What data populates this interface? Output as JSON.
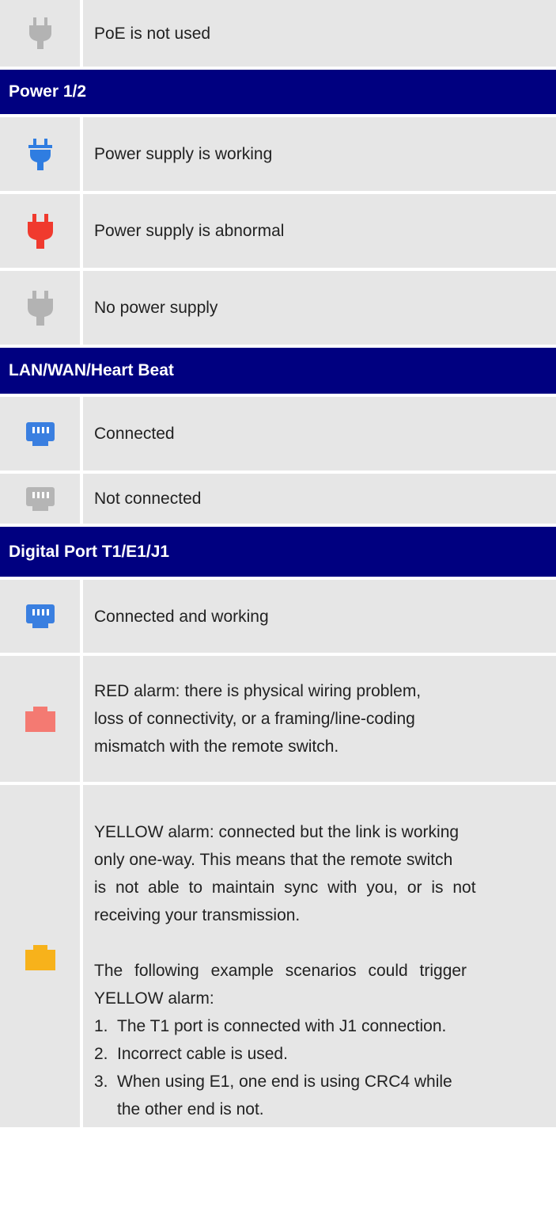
{
  "rows": {
    "poe_not_used": "PoE is not used",
    "power_header": "Power 1/2",
    "power_working": "Power supply is working",
    "power_abnormal": "Power supply is abnormal",
    "no_power": "No power supply",
    "lan_header": "LAN/WAN/Heart Beat",
    "lan_connected": "Connected",
    "lan_not_connected": "Not connected",
    "digital_header": "Digital Port T1/E1/J1",
    "digital_connected": "Connected and working",
    "red_alarm": [
      "RED alarm: there is physical wiring problem,",
      "loss of connectivity, or a framing/line-coding",
      "mismatch with the remote switch."
    ],
    "yellow_alarm": [
      "YELLOW alarm: connected but the link is working",
      "only one-way. This means that the remote switch",
      "is not able to maintain sync with you, or is not",
      "receiving your transmission."
    ],
    "yellow_scenarios_intro": [
      "The following example scenarios could trigger",
      "YELLOW alarm:"
    ],
    "yellow_scenarios": [
      {
        "num": "1.",
        "text": "The T1 port is connected with J1 connection."
      },
      {
        "num": "2.",
        "text": "Incorrect cable is used."
      },
      {
        "num": "3.",
        "text": "When using E1, one end is using CRC4 while"
      },
      {
        "num": "",
        "text": "the other end is not."
      }
    ]
  },
  "icons": {
    "plug_gray": "plug-icon",
    "plug_blue": "plug-icon",
    "plug_red": "plug-icon",
    "ethernet_blue": "ethernet-port-icon",
    "ethernet_gray": "ethernet-port-icon",
    "port_red": "port-alarm-icon",
    "port_yellow": "port-alarm-icon"
  },
  "colors": {
    "header_bg": "#000080",
    "cell_bg": "#e6e6e6",
    "plug_gray": "#b3b3b3",
    "plug_blue": "#2f7de1",
    "plug_red": "#f03a2e",
    "ethernet_blue": "#3a7fe0",
    "ethernet_gray": "#b5b5b5",
    "port_red": "#f47a72",
    "port_yellow": "#f7b21b"
  }
}
